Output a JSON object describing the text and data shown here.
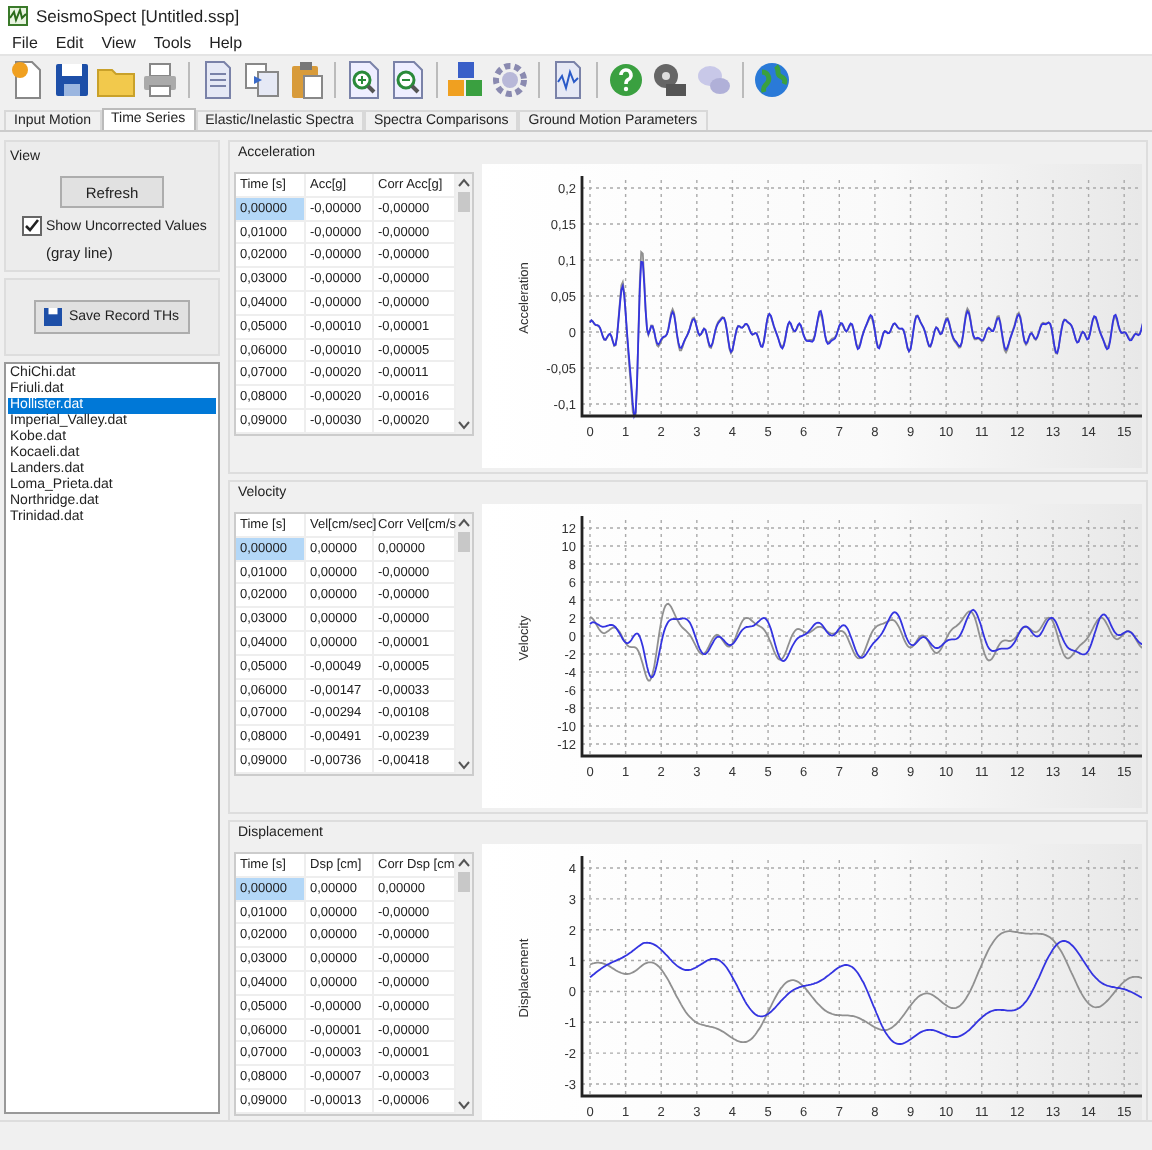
{
  "window": {
    "title": "SeismoSpect  [Untitled.ssp]"
  },
  "menu": [
    "File",
    "Edit",
    "View",
    "Tools",
    "Help"
  ],
  "tabs": [
    {
      "label": "Input Motion",
      "selected": false
    },
    {
      "label": "Time Series",
      "selected": true
    },
    {
      "label": "Elastic/Inelastic Spectra",
      "selected": false
    },
    {
      "label": "Spectra Comparisons",
      "selected": false
    },
    {
      "label": "Ground Motion Parameters",
      "selected": false
    }
  ],
  "view": {
    "title": "View",
    "refresh_button": "Refresh",
    "show_uncorrected": {
      "label": "Show Uncorrected Values",
      "note": "(gray line)",
      "checked": true
    },
    "save_button": "Save Record THs"
  },
  "records": [
    {
      "label": "ChiChi.dat",
      "selected": false
    },
    {
      "label": "Friuli.dat",
      "selected": false
    },
    {
      "label": "Hollister.dat",
      "selected": true
    },
    {
      "label": "Imperial_Valley.dat",
      "selected": false
    },
    {
      "label": "Kobe.dat",
      "selected": false
    },
    {
      "label": "Kocaeli.dat",
      "selected": false
    },
    {
      "label": "Landers.dat",
      "selected": false
    },
    {
      "label": "Loma_Prieta.dat",
      "selected": false
    },
    {
      "label": "Northridge.dat",
      "selected": false
    },
    {
      "label": "Trinidad.dat",
      "selected": false
    }
  ],
  "sections": [
    {
      "title": "Acceleration",
      "columns": [
        "Time [s]",
        "Acc[g]",
        "Corr Acc[g]"
      ],
      "rows": [
        {
          "cells": [
            "0,00000",
            "-0,00000",
            "-0,00000"
          ],
          "selected": true
        },
        {
          "cells": [
            "0,01000",
            "-0,00000",
            "-0,00000"
          ],
          "selected": false
        },
        {
          "cells": [
            "0,02000",
            "-0,00000",
            "-0,00000"
          ],
          "selected": false
        },
        {
          "cells": [
            "0,03000",
            "-0,00000",
            "-0,00000"
          ],
          "selected": false
        },
        {
          "cells": [
            "0,04000",
            "-0,00000",
            "-0,00000"
          ],
          "selected": false
        },
        {
          "cells": [
            "0,05000",
            "-0,00010",
            "-0,00001"
          ],
          "selected": false
        },
        {
          "cells": [
            "0,06000",
            "-0,00010",
            "-0,00005"
          ],
          "selected": false
        },
        {
          "cells": [
            "0,07000",
            "-0,00020",
            "-0,00011"
          ],
          "selected": false
        },
        {
          "cells": [
            "0,08000",
            "-0,00020",
            "-0,00016"
          ],
          "selected": false
        },
        {
          "cells": [
            "0,09000",
            "-0,00030",
            "-0,00020"
          ],
          "selected": false
        }
      ],
      "chart": {
        "ylabel": "Acceleration",
        "yticks": [
          "0,2",
          "0,15",
          "0,1",
          "0,05",
          "0",
          "-0,05",
          "-0,1"
        ],
        "xticks": [
          "0",
          "1",
          "2",
          "3",
          "4",
          "5",
          "6",
          "7",
          "8",
          "9",
          "10",
          "11",
          "12",
          "13",
          "14",
          "15"
        ]
      }
    },
    {
      "title": "Velocity",
      "columns": [
        "Time [s]",
        "Vel[cm/sec]",
        "Corr Vel[cm/s"
      ],
      "rows": [
        {
          "cells": [
            "0,00000",
            "0,00000",
            "0,00000"
          ],
          "selected": true
        },
        {
          "cells": [
            "0,01000",
            "0,00000",
            "-0,00000"
          ],
          "selected": false
        },
        {
          "cells": [
            "0,02000",
            "0,00000",
            "-0,00000"
          ],
          "selected": false
        },
        {
          "cells": [
            "0,03000",
            "0,00000",
            "-0,00000"
          ],
          "selected": false
        },
        {
          "cells": [
            "0,04000",
            "0,00000",
            "-0,00001"
          ],
          "selected": false
        },
        {
          "cells": [
            "0,05000",
            "-0,00049",
            "-0,00005"
          ],
          "selected": false
        },
        {
          "cells": [
            "0,06000",
            "-0,00147",
            "-0,00033"
          ],
          "selected": false
        },
        {
          "cells": [
            "0,07000",
            "-0,00294",
            "-0,00108"
          ],
          "selected": false
        },
        {
          "cells": [
            "0,08000",
            "-0,00491",
            "-0,00239"
          ],
          "selected": false
        },
        {
          "cells": [
            "0,09000",
            "-0,00736",
            "-0,00418"
          ],
          "selected": false
        }
      ],
      "chart": {
        "ylabel": "Velocity",
        "yticks": [
          "12",
          "10",
          "8",
          "6",
          "4",
          "2",
          "0",
          "-2",
          "-4",
          "-6",
          "-8",
          "-10",
          "-12"
        ],
        "xticks": [
          "0",
          "1",
          "2",
          "3",
          "4",
          "5",
          "6",
          "7",
          "8",
          "9",
          "10",
          "11",
          "12",
          "13",
          "14",
          "15"
        ]
      }
    },
    {
      "title": "Displacement",
      "columns": [
        "Time [s]",
        "Dsp [cm]",
        "Corr Dsp [cm"
      ],
      "rows": [
        {
          "cells": [
            "0,00000",
            "0,00000",
            "0,00000"
          ],
          "selected": true
        },
        {
          "cells": [
            "0,01000",
            "0,00000",
            "-0,00000"
          ],
          "selected": false
        },
        {
          "cells": [
            "0,02000",
            "0,00000",
            "-0,00000"
          ],
          "selected": false
        },
        {
          "cells": [
            "0,03000",
            "0,00000",
            "-0,00000"
          ],
          "selected": false
        },
        {
          "cells": [
            "0,04000",
            "0,00000",
            "-0,00000"
          ],
          "selected": false
        },
        {
          "cells": [
            "0,05000",
            "-0,00000",
            "-0,00000"
          ],
          "selected": false
        },
        {
          "cells": [
            "0,06000",
            "-0,00001",
            "-0,00000"
          ],
          "selected": false
        },
        {
          "cells": [
            "0,07000",
            "-0,00003",
            "-0,00001"
          ],
          "selected": false
        },
        {
          "cells": [
            "0,08000",
            "-0,00007",
            "-0,00003"
          ],
          "selected": false
        },
        {
          "cells": [
            "0,09000",
            "-0,00013",
            "-0,00006"
          ],
          "selected": false
        }
      ],
      "chart": {
        "ylabel": "Displacement",
        "yticks": [
          "4",
          "3",
          "2",
          "1",
          "0",
          "-1",
          "-2",
          "-3"
        ],
        "xticks": [
          "0",
          "1",
          "2",
          "3",
          "4",
          "5",
          "6",
          "7",
          "8",
          "9",
          "10",
          "11",
          "12",
          "13",
          "14",
          "15"
        ]
      }
    }
  ]
}
